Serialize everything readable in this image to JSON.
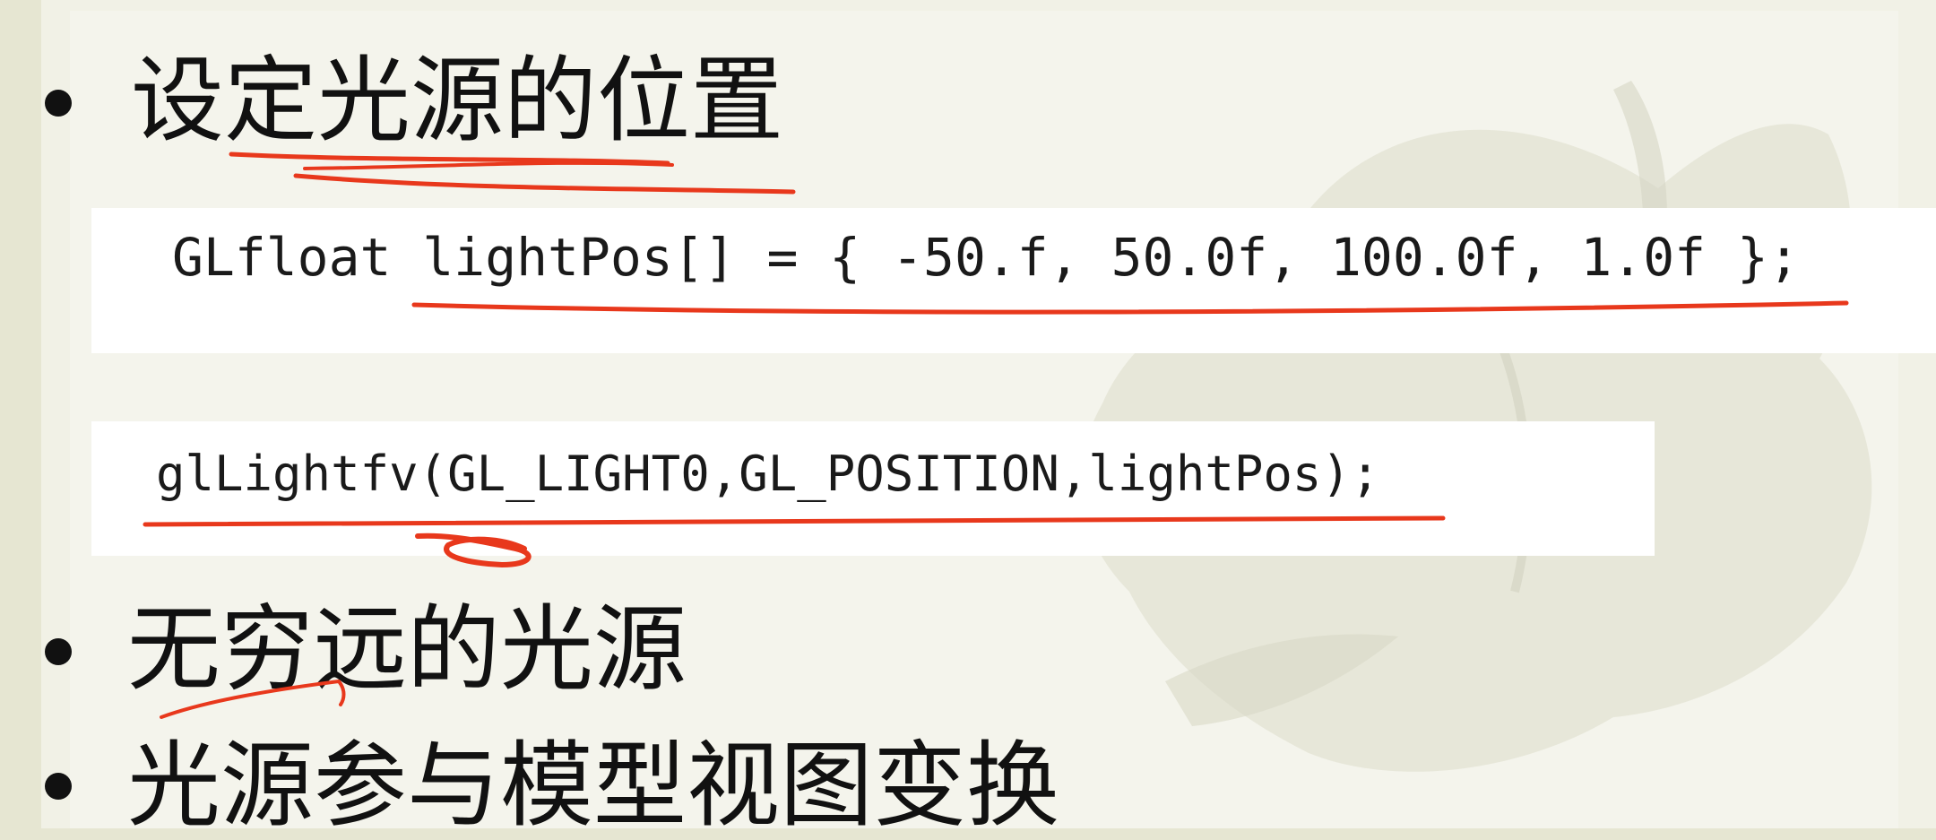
{
  "slide": {
    "background_color": "#f1f1e6",
    "accent_ink_color": "#e8381c"
  },
  "bullets": [
    {
      "text": "设定光源的位置"
    },
    {
      "text": "无穷远的光源"
    },
    {
      "text": "光源参与模型视图变换"
    }
  ],
  "code": {
    "line1": "GLfloat lightPos[] = { -50.f, 50.0f, 100.0f, 1.0f };",
    "line2": "glLightfv(GL_LIGHT0,GL_POSITION,lightPos);"
  },
  "decor": {
    "watermark": "leaf-watermark-icon",
    "annotations": "red-pen-underline-icon"
  }
}
